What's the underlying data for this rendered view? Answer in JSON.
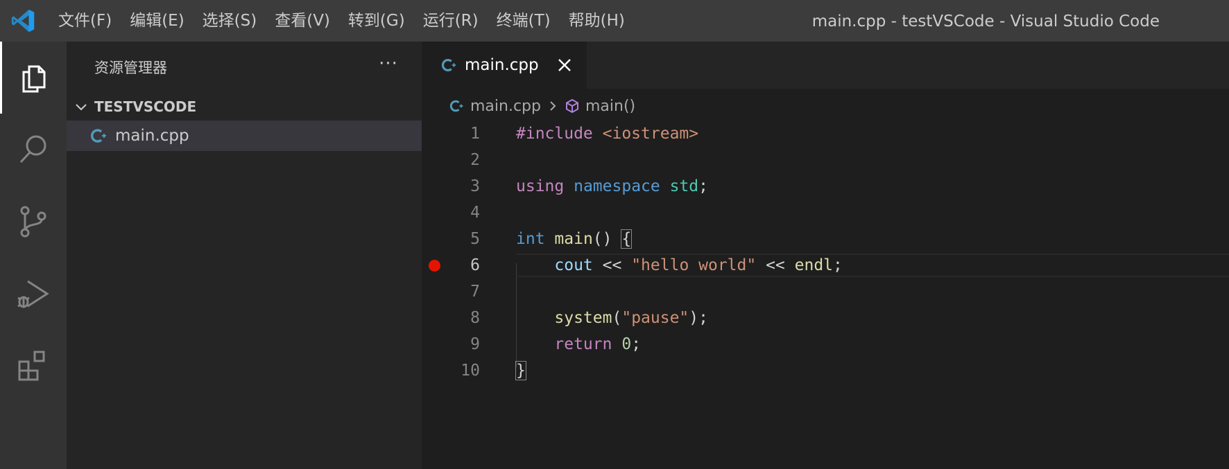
{
  "window": {
    "title": "main.cpp - testVSCode - Visual Studio Code",
    "menu": [
      "文件(F)",
      "编辑(E)",
      "选择(S)",
      "查看(V)",
      "转到(G)",
      "运行(R)",
      "终端(T)",
      "帮助(H)"
    ]
  },
  "activity_bar": {
    "items": [
      {
        "name": "explorer",
        "icon": "files-icon",
        "active": true
      },
      {
        "name": "search",
        "icon": "search-icon",
        "active": false
      },
      {
        "name": "source-control",
        "icon": "source-control-icon",
        "active": false
      },
      {
        "name": "run-debug",
        "icon": "run-debug-icon",
        "active": false
      },
      {
        "name": "extensions",
        "icon": "extensions-icon",
        "active": false
      }
    ]
  },
  "sidebar": {
    "title": "资源管理器",
    "more_label": "···",
    "folder": "TESTVSCODE",
    "files": [
      {
        "name": "main.cpp",
        "selected": true
      }
    ]
  },
  "editor": {
    "tab": {
      "label": "main.cpp",
      "icon": "cpp-file-icon"
    },
    "breadcrumb": {
      "file": "main.cpp",
      "symbol": "main()"
    },
    "current_line": 6,
    "breakpoint_line": 6,
    "lines": [
      {
        "n": "1"
      },
      {
        "n": "2"
      },
      {
        "n": "3"
      },
      {
        "n": "4"
      },
      {
        "n": "5"
      },
      {
        "n": "6"
      },
      {
        "n": "7"
      },
      {
        "n": "8"
      },
      {
        "n": "9"
      },
      {
        "n": "10"
      }
    ],
    "code": {
      "l1_directive": "#include",
      "l1_header": "<iostream>",
      "l3_using": "using",
      "l3_namespace": "namespace",
      "l3_std": "std",
      "l3_semi": ";",
      "l5_int": "int",
      "l5_main": "main",
      "l5_parens": "()",
      "l5_brace": "{",
      "l6_cout": "cout",
      "l6_op1": "<<",
      "l6_str": "\"hello world\"",
      "l6_op2": "<<",
      "l6_endl": "endl",
      "l6_semi": ";",
      "l8_system": "system",
      "l8_open": "(",
      "l8_str": "\"pause\"",
      "l8_close": ");",
      "l9_return": "return",
      "l9_zero": "0",
      "l9_semi": ";",
      "l10_brace": "}"
    },
    "colors": {
      "keyword_control": "#c586c0",
      "keyword_storage": "#569cd6",
      "string": "#ce9178",
      "type": "#4ec9b0",
      "function": "#dcdcaa",
      "variable": "#9cdcfe",
      "number": "#b5cea8",
      "breakpoint": "#e51400"
    }
  }
}
